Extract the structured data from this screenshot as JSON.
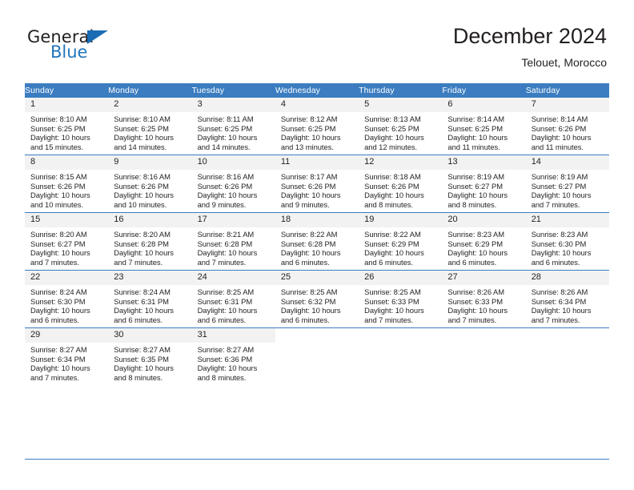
{
  "brand": {
    "name_part1": "General",
    "name_part2": "Blue",
    "logo_icon": "triangle-flag-icon"
  },
  "header": {
    "title": "December 2024",
    "subtitle": "Telouet, Morocco"
  },
  "colors": {
    "header_blue": "#3b7dc0",
    "daynum_band": "#f2f2f2",
    "brand_blue": "#2176bd",
    "text": "#231f20"
  },
  "weekday_headers": [
    "Sunday",
    "Monday",
    "Tuesday",
    "Wednesday",
    "Thursday",
    "Friday",
    "Saturday"
  ],
  "weeks": [
    [
      {
        "day": "1",
        "sunrise": "Sunrise: 8:10 AM",
        "sunset": "Sunset: 6:25 PM",
        "daylight_line1": "Daylight: 10 hours",
        "daylight_line2": "and 15 minutes."
      },
      {
        "day": "2",
        "sunrise": "Sunrise: 8:10 AM",
        "sunset": "Sunset: 6:25 PM",
        "daylight_line1": "Daylight: 10 hours",
        "daylight_line2": "and 14 minutes."
      },
      {
        "day": "3",
        "sunrise": "Sunrise: 8:11 AM",
        "sunset": "Sunset: 6:25 PM",
        "daylight_line1": "Daylight: 10 hours",
        "daylight_line2": "and 14 minutes."
      },
      {
        "day": "4",
        "sunrise": "Sunrise: 8:12 AM",
        "sunset": "Sunset: 6:25 PM",
        "daylight_line1": "Daylight: 10 hours",
        "daylight_line2": "and 13 minutes."
      },
      {
        "day": "5",
        "sunrise": "Sunrise: 8:13 AM",
        "sunset": "Sunset: 6:25 PM",
        "daylight_line1": "Daylight: 10 hours",
        "daylight_line2": "and 12 minutes."
      },
      {
        "day": "6",
        "sunrise": "Sunrise: 8:14 AM",
        "sunset": "Sunset: 6:25 PM",
        "daylight_line1": "Daylight: 10 hours",
        "daylight_line2": "and 11 minutes."
      },
      {
        "day": "7",
        "sunrise": "Sunrise: 8:14 AM",
        "sunset": "Sunset: 6:26 PM",
        "daylight_line1": "Daylight: 10 hours",
        "daylight_line2": "and 11 minutes."
      }
    ],
    [
      {
        "day": "8",
        "sunrise": "Sunrise: 8:15 AM",
        "sunset": "Sunset: 6:26 PM",
        "daylight_line1": "Daylight: 10 hours",
        "daylight_line2": "and 10 minutes."
      },
      {
        "day": "9",
        "sunrise": "Sunrise: 8:16 AM",
        "sunset": "Sunset: 6:26 PM",
        "daylight_line1": "Daylight: 10 hours",
        "daylight_line2": "and 10 minutes."
      },
      {
        "day": "10",
        "sunrise": "Sunrise: 8:16 AM",
        "sunset": "Sunset: 6:26 PM",
        "daylight_line1": "Daylight: 10 hours",
        "daylight_line2": "and 9 minutes."
      },
      {
        "day": "11",
        "sunrise": "Sunrise: 8:17 AM",
        "sunset": "Sunset: 6:26 PM",
        "daylight_line1": "Daylight: 10 hours",
        "daylight_line2": "and 9 minutes."
      },
      {
        "day": "12",
        "sunrise": "Sunrise: 8:18 AM",
        "sunset": "Sunset: 6:26 PM",
        "daylight_line1": "Daylight: 10 hours",
        "daylight_line2": "and 8 minutes."
      },
      {
        "day": "13",
        "sunrise": "Sunrise: 8:19 AM",
        "sunset": "Sunset: 6:27 PM",
        "daylight_line1": "Daylight: 10 hours",
        "daylight_line2": "and 8 minutes."
      },
      {
        "day": "14",
        "sunrise": "Sunrise: 8:19 AM",
        "sunset": "Sunset: 6:27 PM",
        "daylight_line1": "Daylight: 10 hours",
        "daylight_line2": "and 7 minutes."
      }
    ],
    [
      {
        "day": "15",
        "sunrise": "Sunrise: 8:20 AM",
        "sunset": "Sunset: 6:27 PM",
        "daylight_line1": "Daylight: 10 hours",
        "daylight_line2": "and 7 minutes."
      },
      {
        "day": "16",
        "sunrise": "Sunrise: 8:20 AM",
        "sunset": "Sunset: 6:28 PM",
        "daylight_line1": "Daylight: 10 hours",
        "daylight_line2": "and 7 minutes."
      },
      {
        "day": "17",
        "sunrise": "Sunrise: 8:21 AM",
        "sunset": "Sunset: 6:28 PM",
        "daylight_line1": "Daylight: 10 hours",
        "daylight_line2": "and 7 minutes."
      },
      {
        "day": "18",
        "sunrise": "Sunrise: 8:22 AM",
        "sunset": "Sunset: 6:28 PM",
        "daylight_line1": "Daylight: 10 hours",
        "daylight_line2": "and 6 minutes."
      },
      {
        "day": "19",
        "sunrise": "Sunrise: 8:22 AM",
        "sunset": "Sunset: 6:29 PM",
        "daylight_line1": "Daylight: 10 hours",
        "daylight_line2": "and 6 minutes."
      },
      {
        "day": "20",
        "sunrise": "Sunrise: 8:23 AM",
        "sunset": "Sunset: 6:29 PM",
        "daylight_line1": "Daylight: 10 hours",
        "daylight_line2": "and 6 minutes."
      },
      {
        "day": "21",
        "sunrise": "Sunrise: 8:23 AM",
        "sunset": "Sunset: 6:30 PM",
        "daylight_line1": "Daylight: 10 hours",
        "daylight_line2": "and 6 minutes."
      }
    ],
    [
      {
        "day": "22",
        "sunrise": "Sunrise: 8:24 AM",
        "sunset": "Sunset: 6:30 PM",
        "daylight_line1": "Daylight: 10 hours",
        "daylight_line2": "and 6 minutes."
      },
      {
        "day": "23",
        "sunrise": "Sunrise: 8:24 AM",
        "sunset": "Sunset: 6:31 PM",
        "daylight_line1": "Daylight: 10 hours",
        "daylight_line2": "and 6 minutes."
      },
      {
        "day": "24",
        "sunrise": "Sunrise: 8:25 AM",
        "sunset": "Sunset: 6:31 PM",
        "daylight_line1": "Daylight: 10 hours",
        "daylight_line2": "and 6 minutes."
      },
      {
        "day": "25",
        "sunrise": "Sunrise: 8:25 AM",
        "sunset": "Sunset: 6:32 PM",
        "daylight_line1": "Daylight: 10 hours",
        "daylight_line2": "and 6 minutes."
      },
      {
        "day": "26",
        "sunrise": "Sunrise: 8:25 AM",
        "sunset": "Sunset: 6:33 PM",
        "daylight_line1": "Daylight: 10 hours",
        "daylight_line2": "and 7 minutes."
      },
      {
        "day": "27",
        "sunrise": "Sunrise: 8:26 AM",
        "sunset": "Sunset: 6:33 PM",
        "daylight_line1": "Daylight: 10 hours",
        "daylight_line2": "and 7 minutes."
      },
      {
        "day": "28",
        "sunrise": "Sunrise: 8:26 AM",
        "sunset": "Sunset: 6:34 PM",
        "daylight_line1": "Daylight: 10 hours",
        "daylight_line2": "and 7 minutes."
      }
    ],
    [
      {
        "day": "29",
        "sunrise": "Sunrise: 8:27 AM",
        "sunset": "Sunset: 6:34 PM",
        "daylight_line1": "Daylight: 10 hours",
        "daylight_line2": "and 7 minutes."
      },
      {
        "day": "30",
        "sunrise": "Sunrise: 8:27 AM",
        "sunset": "Sunset: 6:35 PM",
        "daylight_line1": "Daylight: 10 hours",
        "daylight_line2": "and 8 minutes."
      },
      {
        "day": "31",
        "sunrise": "Sunrise: 8:27 AM",
        "sunset": "Sunset: 6:36 PM",
        "daylight_line1": "Daylight: 10 hours",
        "daylight_line2": "and 8 minutes."
      },
      {
        "day": "",
        "sunrise": "",
        "sunset": "",
        "daylight_line1": "",
        "daylight_line2": ""
      },
      {
        "day": "",
        "sunrise": "",
        "sunset": "",
        "daylight_line1": "",
        "daylight_line2": ""
      },
      {
        "day": "",
        "sunrise": "",
        "sunset": "",
        "daylight_line1": "",
        "daylight_line2": ""
      },
      {
        "day": "",
        "sunrise": "",
        "sunset": "",
        "daylight_line1": "",
        "daylight_line2": ""
      }
    ]
  ]
}
